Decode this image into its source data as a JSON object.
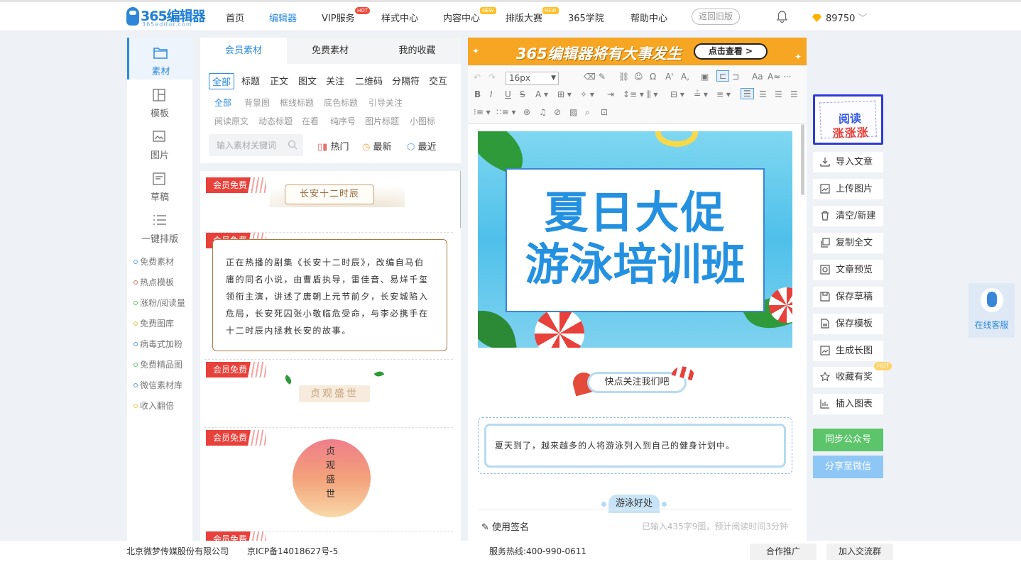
{
  "nav": {
    "brand": "365编辑器",
    "brand_sub": "365editor.com",
    "items": [
      "首页",
      "编辑器",
      "VIP服务",
      "样式中心",
      "内容中心",
      "排版大赛",
      "365学院",
      "帮助中心"
    ],
    "hot_badge": "HOT",
    "new_badge": "NEW",
    "old_version": "返回旧版",
    "coins": "89750"
  },
  "sidebar": {
    "tabs": [
      "素材",
      "模板",
      "图片",
      "草稿",
      "一键排版"
    ],
    "links": [
      "免费素材",
      "热点模板",
      "涨粉/阅读量",
      "免费图库",
      "病毒式加粉",
      "免费精品图",
      "微信素材库",
      "收入翻倍"
    ]
  },
  "materials": {
    "tabs": [
      "会员素材",
      "免费素材",
      "我的收藏"
    ],
    "categories": [
      "全部",
      "标题",
      "正文",
      "图文",
      "关注",
      "二维码",
      "分隔符",
      "交互"
    ],
    "subcats_row1": [
      "全部",
      "背景图",
      "框线标题",
      "底色标题",
      "引导关注"
    ],
    "subcats_row2": [
      "阅读原文",
      "动态标题",
      "在看",
      "纯序号",
      "图片标题",
      "小图标"
    ],
    "search_placeholder": "输入素材关键词",
    "sort": [
      "热门",
      "最新",
      "最近"
    ],
    "tag": "会员免费",
    "item1_title": "长安十二时辰",
    "item2_text": "正在热播的剧集《长安十二时辰》，改编自马伯庸的同名小说，由曹盾执导，雷佳音、易烊千玺领衔主演，讲述了唐朝上元节前夕，长安城陷入危局，长安死囚张小敬临危受命，与李必携手在十二时辰内拯救长安的故事。",
    "item3_title": "贞观盛世",
    "item4_chars": [
      "贞",
      "观",
      "盛",
      "世"
    ]
  },
  "editor": {
    "banner_text": "365编辑器将有大事发生",
    "banner_cta": "点击查看 >",
    "font_size": "16px",
    "poster_line1": "夏日大促",
    "poster_line2": "游泳培训班",
    "follow_text": "快点关注我们吧",
    "body_text": "夏天到了，越来越多的人将游泳列入到自己的健身计划中。",
    "pill_text": "游泳好处",
    "signature": "使用签名",
    "stats": "已输入435字9图，预计阅读时间3分钟"
  },
  "actions": {
    "promo_line1": "阅读",
    "promo_line2": "涨涨涨",
    "items": [
      "导入文章",
      "上传图片",
      "清空/新建",
      "复制全文",
      "文章预览",
      "保存草稿",
      "保存模板",
      "生成长图",
      "收藏有奖",
      "插入图表"
    ],
    "hot": "HOT",
    "sync": "同步公众号",
    "share": "分享至微信",
    "service": "在线客服"
  },
  "footer": {
    "company": "北京微梦传媒股份有限公司",
    "icp": "京ICP备14018627号-5",
    "hotline": "服务热线:400-990-0611",
    "coop": "合作推广",
    "group": "加入交流群"
  }
}
